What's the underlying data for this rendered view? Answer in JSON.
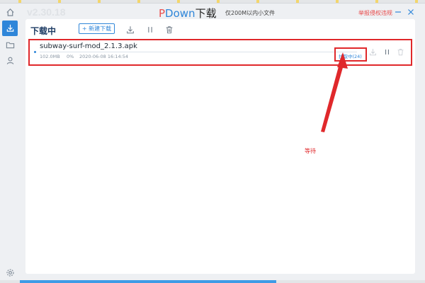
{
  "app": {
    "version": "v2.30.18",
    "title_p": "P",
    "title_rest": "Down",
    "title_cn": "下载",
    "subtitle": "仅200M以内小文件",
    "report_link": "举报侵权违规"
  },
  "panel": {
    "heading": "下载中",
    "new_download_label": "+ 新建下载"
  },
  "downloads": [
    {
      "file_name": "subway-surf-mod_2.1.3.apk",
      "size": "102.0MB",
      "percent": "0%",
      "progress": 0,
      "timestamp": "2020-06-08 16:14:54",
      "status": "拉取中(24)"
    }
  ],
  "annotation": {
    "note": "等待",
    "color": "#e0282b"
  },
  "colors": {
    "accent": "#2f86d9",
    "highlight": "#e0282b",
    "brand_p": "#e94d4d"
  },
  "icons": {
    "sidebar": [
      "home-icon",
      "download-icon",
      "folder-icon",
      "user-icon",
      "settings-icon"
    ],
    "toolbar": [
      "download-all-icon",
      "pause-all-icon",
      "delete-all-icon"
    ],
    "row": [
      "download-icon",
      "pause-icon",
      "delete-icon"
    ],
    "window": [
      "minimize-icon",
      "close-icon"
    ]
  }
}
